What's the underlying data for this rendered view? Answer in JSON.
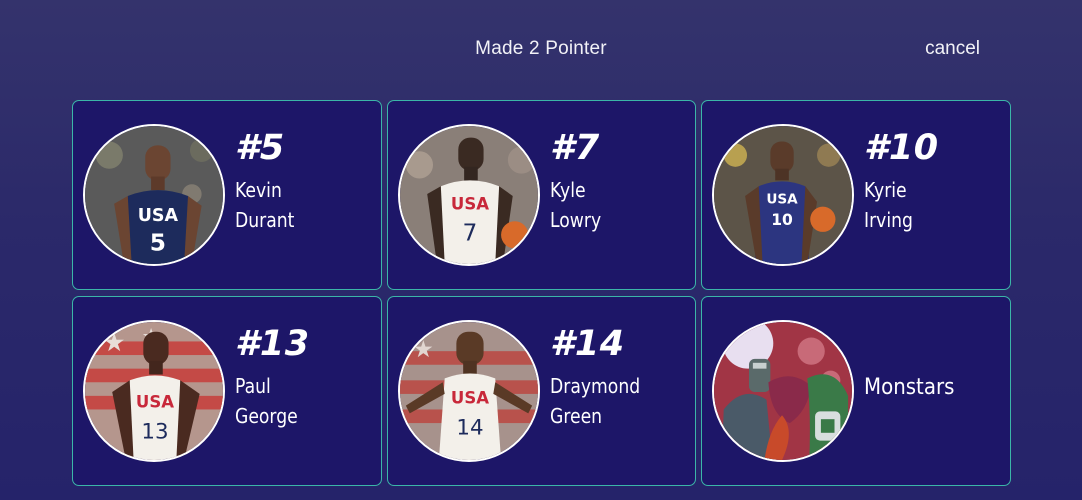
{
  "header": {
    "title": "Made 2 Pointer",
    "cancel_label": "cancel"
  },
  "colors": {
    "background": "#2b296a",
    "card_background": "#1d1668",
    "card_border": "#3bb6a8",
    "text": "#ffffff"
  },
  "players": [
    {
      "number": "#5",
      "first_name": "Kevin",
      "last_name": "Durant",
      "jersey_color": "#1d2b5c",
      "jersey_number": "5"
    },
    {
      "number": "#7",
      "first_name": "Kyle",
      "last_name": "Lowry",
      "jersey_color": "#f3f0ea",
      "jersey_number": "7"
    },
    {
      "number": "#10",
      "first_name": "Kyrie",
      "last_name": "Irving",
      "jersey_color": "#2c3580",
      "jersey_number": "10"
    },
    {
      "number": "#13",
      "first_name": "Paul",
      "last_name": "George",
      "jersey_color": "#f3f0ea",
      "jersey_number": "13"
    },
    {
      "number": "#14",
      "first_name": "Draymond",
      "last_name": "Green",
      "jersey_color": "#f3f0ea",
      "jersey_number": "14"
    }
  ],
  "team": {
    "name": "Monstars"
  }
}
